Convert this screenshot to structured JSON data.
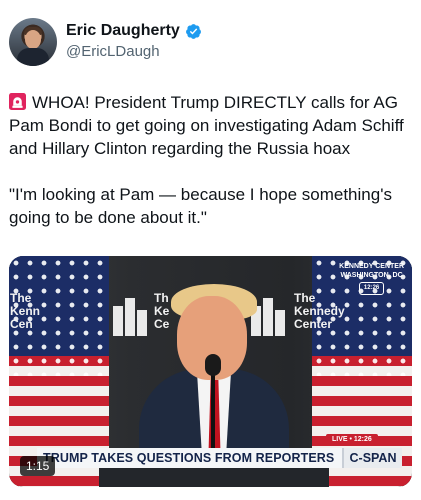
{
  "author": {
    "display_name": "Eric Daugherty",
    "handle": "@EricLDaugh",
    "verified_icon": "verified-badge-icon",
    "verified_color": "#1d9bf0"
  },
  "tweet": {
    "emoji_icon": "rotating-light-icon",
    "text_line1": "WHOA! President Trump DIRECTLY calls for AG Pam Bondi to get going on investigating Adam Schiff and Hillary Clinton regarding the Russia hoax",
    "text_line2": "\"I'm looking at Pam — because I hope something's going to be done about it.\""
  },
  "video": {
    "backdrop_logo_text": "The Kennedy Center",
    "backdrop_logo_left_partial": "The Kenn Cen",
    "backdrop_logo_middle_partial": "Th Ke Ce",
    "bug_line1": "KENNEDY CENTER",
    "bug_line2": "WASHINGTON, DC",
    "bug_time": "12:26",
    "live_label": "LIVE • 12:26",
    "chyron_text": "TRUMP TAKES QUESTIONS FROM REPORTERS",
    "network_label": "C-SPAN",
    "duration": "1:15"
  },
  "colors": {
    "text_primary": "#0f1419",
    "text_secondary": "#536471",
    "chyron_navy": "#14244a",
    "live_red": "#c8202f"
  }
}
